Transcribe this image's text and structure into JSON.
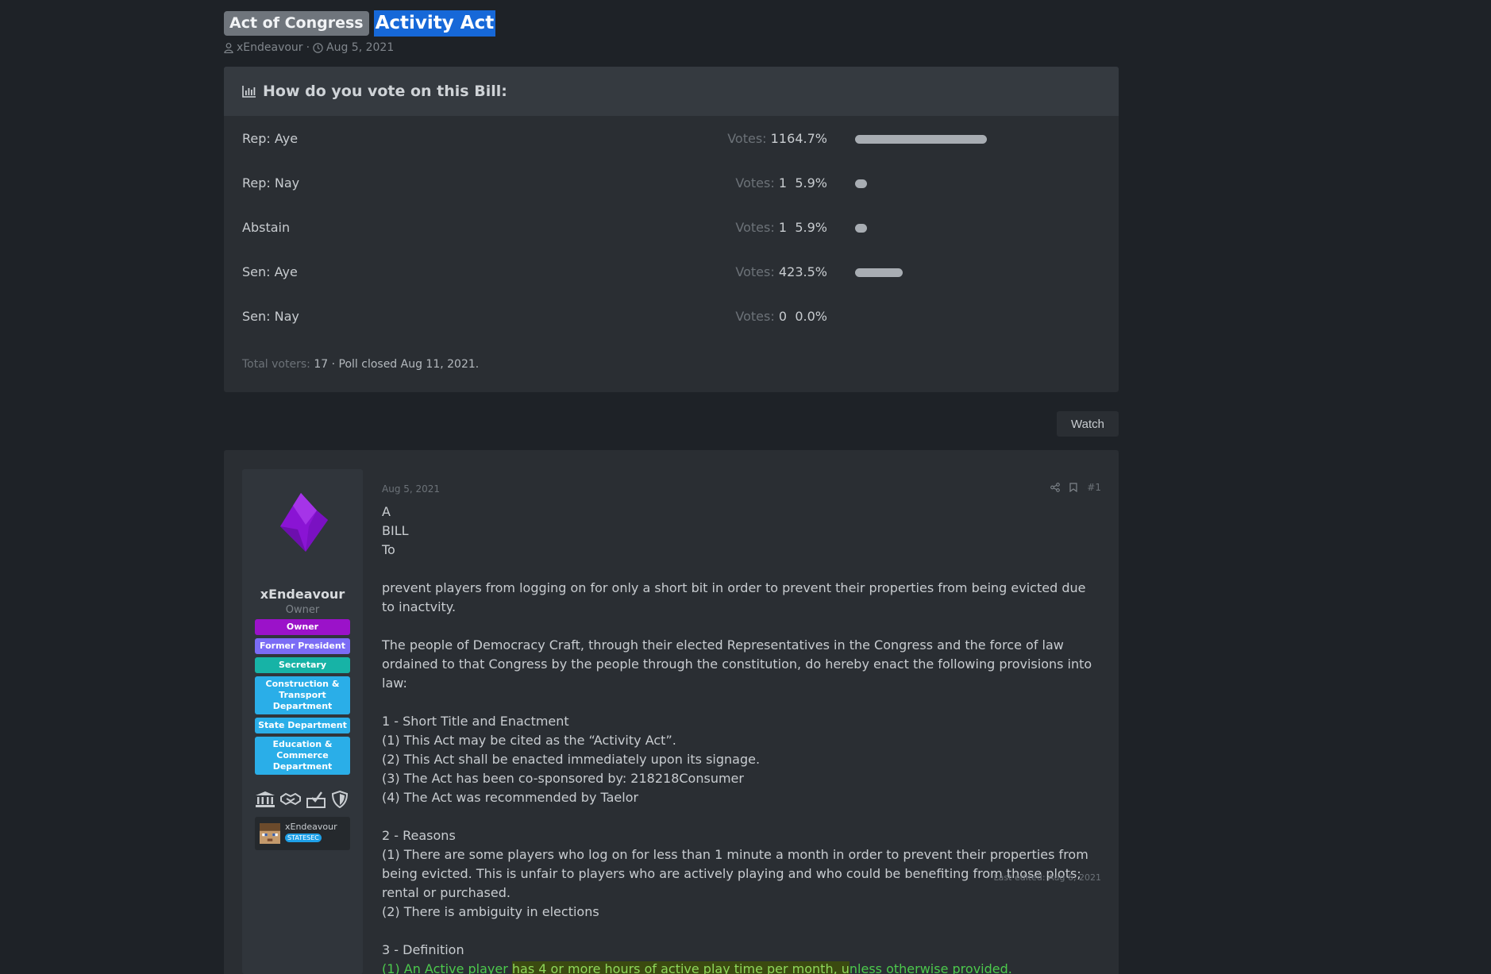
{
  "thread": {
    "prefix": "Act of Congress",
    "title": "Activity Act",
    "author": "xEndeavour",
    "separator": "·",
    "date": "Aug 5, 2021"
  },
  "poll": {
    "title": "How do you vote on this Bill:",
    "votes_label": "Votes:",
    "options": [
      {
        "label": "Rep: Aye",
        "votes": "11",
        "percent": "64.7%",
        "fraction": 0.647
      },
      {
        "label": "Rep: Nay",
        "votes": "1",
        "percent": "5.9%",
        "fraction": 0.059
      },
      {
        "label": "Abstain",
        "votes": "1",
        "percent": "5.9%",
        "fraction": 0.059
      },
      {
        "label": "Sen: Aye",
        "votes": "4",
        "percent": "23.5%",
        "fraction": 0.235
      },
      {
        "label": "Sen: Nay",
        "votes": "0",
        "percent": "0.0%",
        "fraction": 0.0
      }
    ],
    "total_voters_label": "Total voters:",
    "total_voters": "17",
    "closed_text": "· Poll closed Aug 11, 2021."
  },
  "watch_label": "Watch",
  "post": {
    "user": {
      "name": "xEndeavour",
      "title": "Owner",
      "banners": [
        {
          "text": "Owner",
          "color": "#9b12c9"
        },
        {
          "text": "Former President",
          "color": "#7b6cf5"
        },
        {
          "text": "Secretary",
          "color": "#17b3a6"
        },
        {
          "text": "Construction & Transport Department",
          "color": "#2aaee8"
        },
        {
          "text": "State Department",
          "color": "#2aaee8"
        },
        {
          "text": "Education & Commerce Department",
          "color": "#2aaee8"
        }
      ],
      "mini_name": "xEndeavour",
      "mini_badge": "STATESEC"
    },
    "date": "Aug 5, 2021",
    "number": "#1",
    "body": {
      "l1": "A",
      "l2": "BILL",
      "l3": "To",
      "l4": "prevent players from logging on for only a short bit in order to prevent their properties from being evicted due to inactvity.",
      "l5": "The people of Democracy Craft, through their elected Representatives in the Congress and the force of law ordained to that Congress by the people through the constitution, do hereby enact the following provisions into law:",
      "s1": "1 - Short Title and Enactment",
      "s1a": "(1) This Act may be cited as the “Activity Act”.",
      "s1b": "(2) This Act shall be enacted immediately upon its signage.",
      "s1c": "(3) The Act has been co-sponsored by: 218218Consumer",
      "s1d": "(4) The Act was recommended by Taelor",
      "s2": "2 - Reasons",
      "s2a": "(1) There are some players who log on for less than 1 minute a month in order to prevent their properties from being evicted. This is unfair to players who are actively playing and who could be benefiting from those plots; rental or purchased.",
      "s2b": "(2) There is ambiguity in elections",
      "s3": "3 - Definition",
      "s3a_pre": "(1) An Active player ",
      "s3a_hl": "has 4 or more hours of active play time per month, u",
      "s3a_post": "nless otherwise provided."
    },
    "last_edited": "Last edited: Aug 6, 2021"
  }
}
